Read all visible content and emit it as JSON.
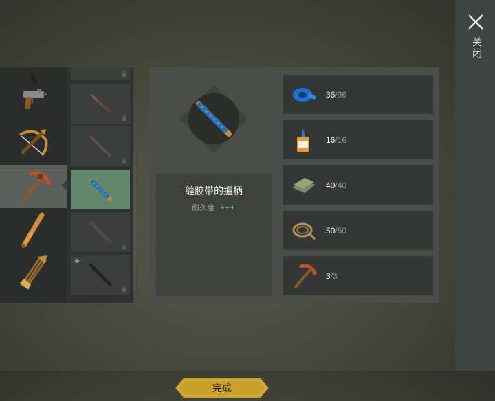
{
  "close": {
    "label": "关闭",
    "icon": "close-icon"
  },
  "categories": [
    {
      "icon": "pistol-icon",
      "selected": false
    },
    {
      "icon": "crossbow-icon",
      "selected": false
    },
    {
      "icon": "pickaxe-icon",
      "selected": true
    },
    {
      "icon": "bat-icon",
      "selected": false
    },
    {
      "icon": "arrows-icon",
      "selected": false
    }
  ],
  "items": [
    {
      "icon": "knife-icon",
      "locked": true
    },
    {
      "icon": "stick-icon",
      "locked": true
    },
    {
      "icon": "taped-handle-icon",
      "locked": false,
      "selected": true
    },
    {
      "icon": "wrapped-stick-icon",
      "locked": true
    },
    {
      "icon": "dark-stick-icon",
      "locked": true,
      "starred": true
    }
  ],
  "detail": {
    "name": "缠胶带的握柄",
    "durability_label": "耐久度",
    "durability_value": "+++",
    "done_label": "完成"
  },
  "requirements": [
    {
      "icon": "duct-tape-icon",
      "count": "36",
      "total": "/36"
    },
    {
      "icon": "glue-icon",
      "count": "16",
      "total": "/16"
    },
    {
      "icon": "cloth-icon",
      "count": "40",
      "total": "/40"
    },
    {
      "icon": "rope-icon",
      "count": "50",
      "total": "/50"
    },
    {
      "icon": "pickaxe-icon",
      "count": "3",
      "total": "/3"
    }
  ],
  "colors": {
    "accent_gold": "#c9a02c",
    "selected_item": "#62866b",
    "durability_green": "#52c46b"
  }
}
